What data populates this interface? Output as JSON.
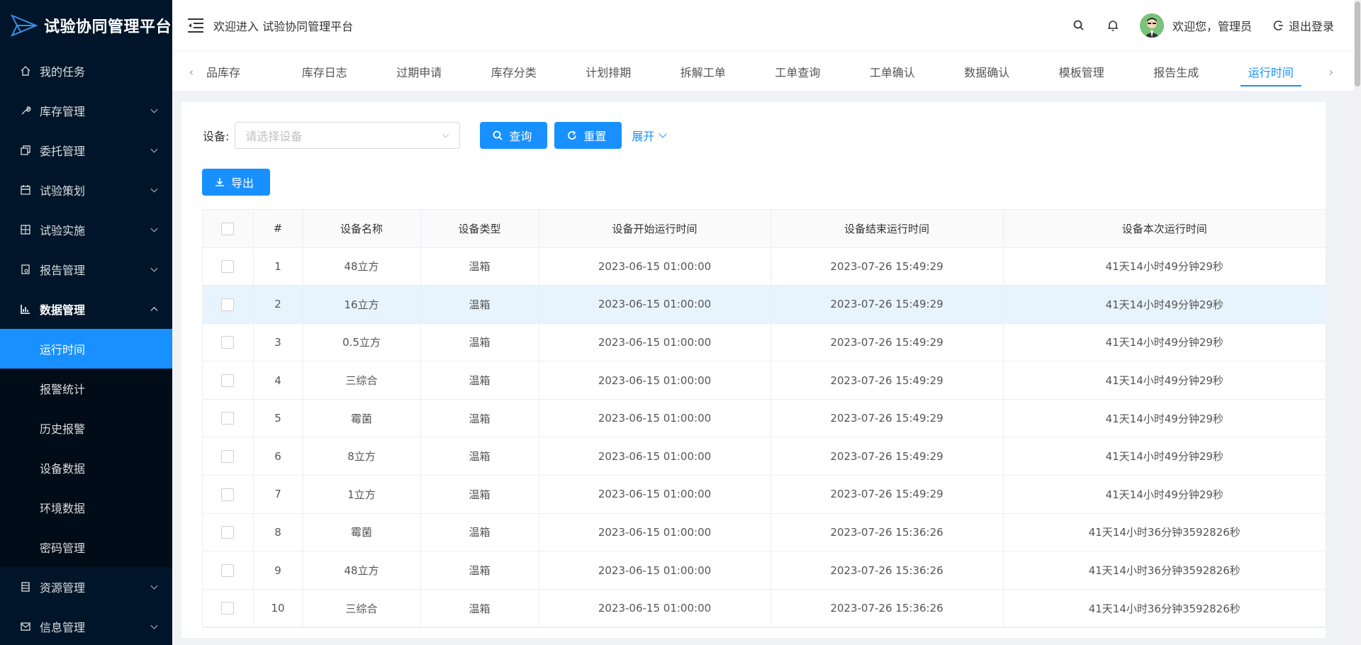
{
  "app": {
    "title": "试验协同管理平台"
  },
  "header": {
    "welcome": "欢迎进入 试验协同管理平台",
    "greeting": "欢迎您，管理员",
    "logout": "退出登录"
  },
  "sidebar": {
    "items": [
      {
        "label": "我的任务",
        "icon": "home-icon"
      },
      {
        "label": "库存管理",
        "icon": "wrench-icon"
      },
      {
        "label": "委托管理",
        "icon": "copy-icon"
      },
      {
        "label": "试验策划",
        "icon": "calendar-icon"
      },
      {
        "label": "试验实施",
        "icon": "grid-icon"
      },
      {
        "label": "报告管理",
        "icon": "report-icon"
      },
      {
        "label": "数据管理",
        "icon": "bar-chart-icon"
      },
      {
        "label": "资源管理",
        "icon": "database-icon"
      },
      {
        "label": "信息管理",
        "icon": "mail-icon"
      }
    ],
    "submenu": [
      "运行时间",
      "报警统计",
      "历史报警",
      "设备数据",
      "环境数据",
      "密码管理"
    ]
  },
  "tabs": [
    "品库存",
    "库存日志",
    "过期申请",
    "库存分类",
    "计划排期",
    "拆解工单",
    "工单查询",
    "工单确认",
    "数据确认",
    "模板管理",
    "报告生成",
    "运行时间"
  ],
  "filter": {
    "label": "设备:",
    "placeholder": "请选择设备",
    "query": "查询",
    "reset": "重置",
    "expand": "展开"
  },
  "export_label": "导出",
  "table": {
    "columns": [
      "#",
      "设备名称",
      "设备类型",
      "设备开始运行时间",
      "设备结束运行时间",
      "设备本次运行时间"
    ],
    "rows": [
      [
        "1",
        "48立方",
        "温箱",
        "2023-06-15 01:00:00",
        "2023-07-26 15:49:29",
        "41天14小时49分钟29秒"
      ],
      [
        "2",
        "16立方",
        "温箱",
        "2023-06-15 01:00:00",
        "2023-07-26 15:49:29",
        "41天14小时49分钟29秒"
      ],
      [
        "3",
        "0.5立方",
        "温箱",
        "2023-06-15 01:00:00",
        "2023-07-26 15:49:29",
        "41天14小时49分钟29秒"
      ],
      [
        "4",
        "三综合",
        "温箱",
        "2023-06-15 01:00:00",
        "2023-07-26 15:49:29",
        "41天14小时49分钟29秒"
      ],
      [
        "5",
        "霉菌",
        "温箱",
        "2023-06-15 01:00:00",
        "2023-07-26 15:49:29",
        "41天14小时49分钟29秒"
      ],
      [
        "6",
        "8立方",
        "温箱",
        "2023-06-15 01:00:00",
        "2023-07-26 15:49:29",
        "41天14小时49分钟29秒"
      ],
      [
        "7",
        "1立方",
        "温箱",
        "2023-06-15 01:00:00",
        "2023-07-26 15:49:29",
        "41天14小时49分钟29秒"
      ],
      [
        "8",
        "霉菌",
        "温箱",
        "2023-06-15 01:00:00",
        "2023-07-26 15:36:26",
        "41天14小时36分钟3592826秒"
      ],
      [
        "9",
        "48立方",
        "温箱",
        "2023-06-15 01:00:00",
        "2023-07-26 15:36:26",
        "41天14小时36分钟3592826秒"
      ],
      [
        "10",
        "三综合",
        "温箱",
        "2023-06-15 01:00:00",
        "2023-07-26 15:36:26",
        "41天14小时36分钟3592826秒"
      ]
    ]
  },
  "colors": {
    "primary": "#1890ff",
    "sidebar_bg": "#001529",
    "submenu_bg": "#000c17",
    "row_highlight": "#e8f4fd"
  }
}
